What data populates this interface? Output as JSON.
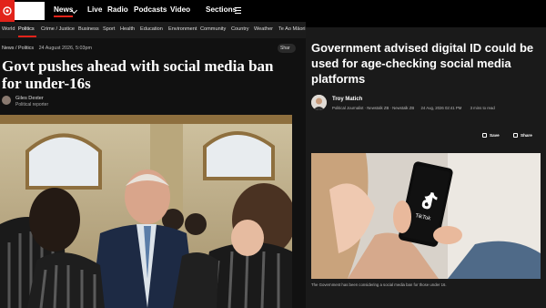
{
  "nav": {
    "items": [
      "News",
      "Live",
      "Radio",
      "Podcasts",
      "Video",
      "Sections"
    ]
  },
  "subnav": {
    "items": [
      "World",
      "Politics",
      "Crime / Justice",
      "Business",
      "Sport",
      "Health",
      "Education",
      "Environment",
      "Community",
      "Country",
      "Weather",
      "Te Ao Māori"
    ]
  },
  "left_article": {
    "breadcrumb": "News / Politics",
    "date": "24 August 2026, 5:03pm",
    "share_label": "Shar",
    "headline": "Govt pushes ahead with social media ban for under-16s",
    "author_name": "Giles Dexter",
    "author_role": "Political reporter"
  },
  "right_article": {
    "headline": "Government advised digital ID could be used for age-checking social media platforms",
    "author_name": "Troy Matich",
    "author_role": "Political Journalist · Newstalk ZB · Newstalk ZB",
    "date": "24 Aug, 2026 02:41 PM",
    "read_time": "3 mins to read",
    "save_label": "Save",
    "share_label": "Share",
    "phone_app_label": "TikTok",
    "caption": "The Government has been considering a social media ban for those under 16."
  },
  "colors": {
    "brand_red": "#e2231a",
    "background_dark": "#111111"
  }
}
